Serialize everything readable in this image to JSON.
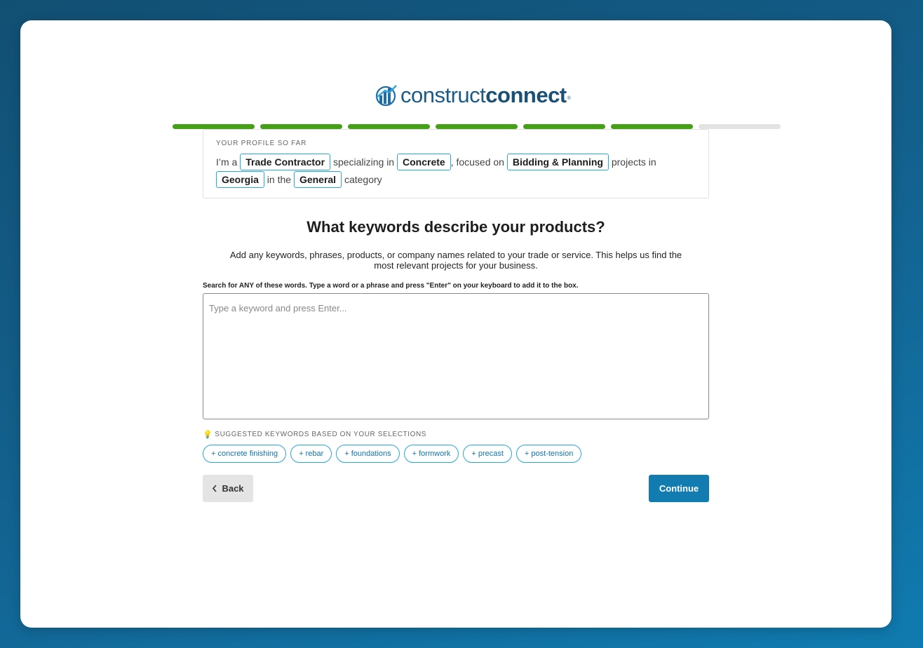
{
  "brand": {
    "logo_light": "construct",
    "logo_bold": "connect",
    "logo_reg": "®",
    "logo_icon": "building-chart-icon"
  },
  "progress": {
    "total_steps": 7,
    "completed_steps": 6,
    "done_color": "#45a018",
    "todo_color": "#e3e3e3"
  },
  "profile": {
    "heading": "YOUR PROFILE SO FAR",
    "t1": "I’m a",
    "role": "Trade Contractor",
    "t2": "specializing in",
    "trade": "Concrete",
    "t3": ", focused on",
    "stage": "Bidding & Planning",
    "t4": "projects in",
    "state": "Georgia",
    "t5": "in the",
    "category": "General",
    "t6": "category"
  },
  "main": {
    "title": "What keywords describe your products?",
    "subtitle_line1": "Add any keywords, phrases, products, or company names related to your trade or service. This helps us find the",
    "subtitle_line2": "most relevant projects for your business.",
    "instructions": "Search for ANY of these words. Type a word or a phrase and press \"Enter\" on your keyboard to add it to the box.",
    "keyword_input": {
      "value": "",
      "placeholder": "Type a keyword and press Enter..."
    }
  },
  "suggestions": {
    "heading": "SUGGESTED KEYWORDS BASED ON YOUR SELECTIONS",
    "icon": "lightbulb-icon",
    "items": [
      "+ concrete finishing",
      "+ rebar",
      "+ foundations",
      "+ formwork",
      "+ precast",
      "+ post-tension"
    ]
  },
  "nav": {
    "back_label": "Back",
    "back_icon": "chevron-left-icon",
    "continue_label": "Continue",
    "accent": "#127bb0"
  }
}
